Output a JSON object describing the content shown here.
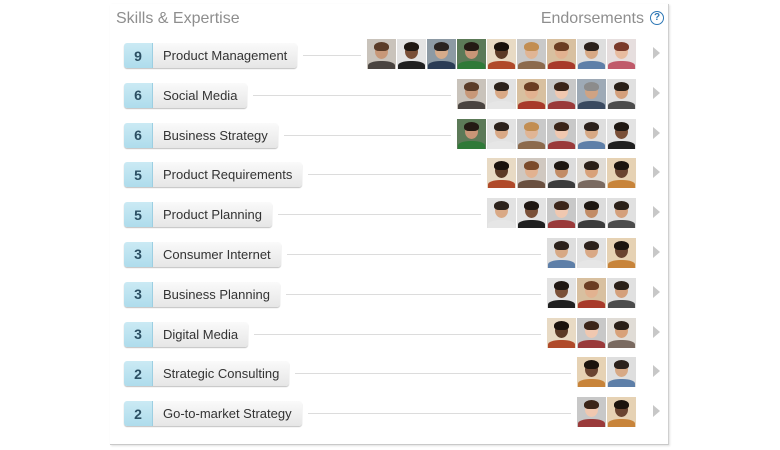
{
  "header": {
    "skills_title": "Skills & Expertise",
    "endorsements_title": "Endorsements",
    "help_icon": "?"
  },
  "colors": {
    "count_bg": "#b6e0ef",
    "pill_bg": "#eeeeee",
    "header_text": "#8e8e8e",
    "help_blue": "#2d77b5",
    "chevron": "#c7c7c7"
  },
  "icons": {
    "row_arrow": "chevron-right-icon",
    "help": "help-icon"
  },
  "skills": [
    {
      "count": "9",
      "name": "Product Management",
      "endorsers": [
        {
          "bg": "#c9c3bb",
          "skin": "#c89878",
          "hair": "#5a3c28",
          "body": "#4a4440"
        },
        {
          "bg": "#e3e3e3",
          "skin": "#7a5038",
          "hair": "#1f1712",
          "body": "#202020"
        },
        {
          "bg": "#8d9aa4",
          "skin": "#d6ab8a",
          "hair": "#2a2320",
          "body": "#2b3c55"
        },
        {
          "bg": "#5c7a58",
          "skin": "#c99677",
          "hair": "#241a14",
          "body": "#2f7a38"
        },
        {
          "bg": "#e8dac4",
          "skin": "#5c3a26",
          "hair": "#1a120c",
          "body": "#b04a2a"
        },
        {
          "bg": "#c9c9c9",
          "skin": "#e0b595",
          "hair": "#c28e52",
          "body": "#8c6a4c"
        },
        {
          "bg": "#d8c0a0",
          "skin": "#e2b290",
          "hair": "#6b3d22",
          "body": "#a83a2a"
        },
        {
          "bg": "#dedede",
          "skin": "#d7a985",
          "hair": "#2b211b",
          "body": "#5e7fa8"
        },
        {
          "bg": "#e6dede",
          "skin": "#e8bca0",
          "hair": "#7a3a2a",
          "body": "#c05a6a"
        }
      ]
    },
    {
      "count": "6",
      "name": "Social Media",
      "endorsers": [
        {
          "bg": "#c9c3bb",
          "skin": "#c89878",
          "hair": "#5a3c28",
          "body": "#4a4440"
        },
        {
          "bg": "#e2e2e2",
          "skin": "#d9a986",
          "hair": "#2c221c",
          "body": "#e6e6e6"
        },
        {
          "bg": "#d8c0a0",
          "skin": "#e2b290",
          "hair": "#6b3d22",
          "body": "#a83a2a"
        },
        {
          "bg": "#c8c8c8",
          "skin": "#f0c8b0",
          "hair": "#3a2418",
          "body": "#9a3a3a"
        },
        {
          "bg": "#9eaab6",
          "skin": "#cfa383",
          "hair": "#8c8c8c",
          "body": "#3a4a60"
        },
        {
          "bg": "#e0e0e0",
          "skin": "#d4a07c",
          "hair": "#2a2018",
          "body": "#4c4c4c"
        }
      ]
    },
    {
      "count": "6",
      "name": "Business Strategy",
      "endorsers": [
        {
          "bg": "#5c7a58",
          "skin": "#c99677",
          "hair": "#241a14",
          "body": "#2f7a38"
        },
        {
          "bg": "#e2e2e2",
          "skin": "#d9a986",
          "hair": "#2c221c",
          "body": "#e6e6e6"
        },
        {
          "bg": "#c9c9c9",
          "skin": "#e0b595",
          "hair": "#c28e52",
          "body": "#8c6a4c"
        },
        {
          "bg": "#c8c8c8",
          "skin": "#f0c8b0",
          "hair": "#3a2418",
          "body": "#9a3a3a"
        },
        {
          "bg": "#dedede",
          "skin": "#d7a985",
          "hair": "#2b211b",
          "body": "#5e7fa8"
        },
        {
          "bg": "#e3e3e3",
          "skin": "#7a5038",
          "hair": "#1f1712",
          "body": "#202020"
        }
      ]
    },
    {
      "count": "5",
      "name": "Product Requirements",
      "endorsers": [
        {
          "bg": "#e8dac4",
          "skin": "#5c3a26",
          "hair": "#1a120c",
          "body": "#b04a2a"
        },
        {
          "bg": "#d0c8c0",
          "skin": "#e2b290",
          "hair": "#7a4a2a",
          "body": "#6a5040"
        },
        {
          "bg": "#dcdcdc",
          "skin": "#c28c66",
          "hair": "#1e1712",
          "body": "#3c3c3c"
        },
        {
          "bg": "#e0dcd6",
          "skin": "#d8a27a",
          "hair": "#2a2018",
          "body": "#7a6a60"
        },
        {
          "bg": "#e6d2b4",
          "skin": "#6a4430",
          "hair": "#1c140e",
          "body": "#c8843a"
        }
      ]
    },
    {
      "count": "5",
      "name": "Product Planning",
      "endorsers": [
        {
          "bg": "#e2e2e2",
          "skin": "#d9a986",
          "hair": "#2c221c",
          "body": "#e6e6e6"
        },
        {
          "bg": "#e3e3e3",
          "skin": "#7a5038",
          "hair": "#1f1712",
          "body": "#202020"
        },
        {
          "bg": "#c8c8c8",
          "skin": "#f0c8b0",
          "hair": "#3a2418",
          "body": "#9a3a3a"
        },
        {
          "bg": "#dcdcdc",
          "skin": "#c28c66",
          "hair": "#1e1712",
          "body": "#3c3c3c"
        },
        {
          "bg": "#e0e0e0",
          "skin": "#d4a07c",
          "hair": "#2a2018",
          "body": "#4c4c4c"
        }
      ]
    },
    {
      "count": "3",
      "name": "Consumer Internet",
      "endorsers": [
        {
          "bg": "#dedede",
          "skin": "#d7a985",
          "hair": "#2b211b",
          "body": "#5e7fa8"
        },
        {
          "bg": "#e2e2e2",
          "skin": "#d9a986",
          "hair": "#2c221c",
          "body": "#e6e6e6"
        },
        {
          "bg": "#e6d2b4",
          "skin": "#6a4430",
          "hair": "#1c140e",
          "body": "#c8843a"
        }
      ]
    },
    {
      "count": "3",
      "name": "Business Planning",
      "endorsers": [
        {
          "bg": "#e3e3e3",
          "skin": "#7a5038",
          "hair": "#1f1712",
          "body": "#202020"
        },
        {
          "bg": "#d8c0a0",
          "skin": "#e2b290",
          "hair": "#6b3d22",
          "body": "#a83a2a"
        },
        {
          "bg": "#e0e0e0",
          "skin": "#d4a07c",
          "hair": "#2a2018",
          "body": "#4c4c4c"
        }
      ]
    },
    {
      "count": "3",
      "name": "Digital Media",
      "endorsers": [
        {
          "bg": "#e8dac4",
          "skin": "#5c3a26",
          "hair": "#1a120c",
          "body": "#b04a2a"
        },
        {
          "bg": "#c8c8c8",
          "skin": "#f0c8b0",
          "hair": "#3a2418",
          "body": "#9a3a3a"
        },
        {
          "bg": "#e0dcd6",
          "skin": "#d8a27a",
          "hair": "#2a2018",
          "body": "#7a6a60"
        }
      ]
    },
    {
      "count": "2",
      "name": "Strategic Consulting",
      "endorsers": [
        {
          "bg": "#e6d2b4",
          "skin": "#6a4430",
          "hair": "#1c140e",
          "body": "#c8843a"
        },
        {
          "bg": "#dedede",
          "skin": "#d7a985",
          "hair": "#2b211b",
          "body": "#5e7fa8"
        }
      ]
    },
    {
      "count": "2",
      "name": "Go-to-market Strategy",
      "endorsers": [
        {
          "bg": "#c8c8c8",
          "skin": "#f0c8b0",
          "hair": "#3a2418",
          "body": "#9a3a3a"
        },
        {
          "bg": "#e6d2b4",
          "skin": "#6a4430",
          "hair": "#1c140e",
          "body": "#c8843a"
        }
      ]
    }
  ]
}
